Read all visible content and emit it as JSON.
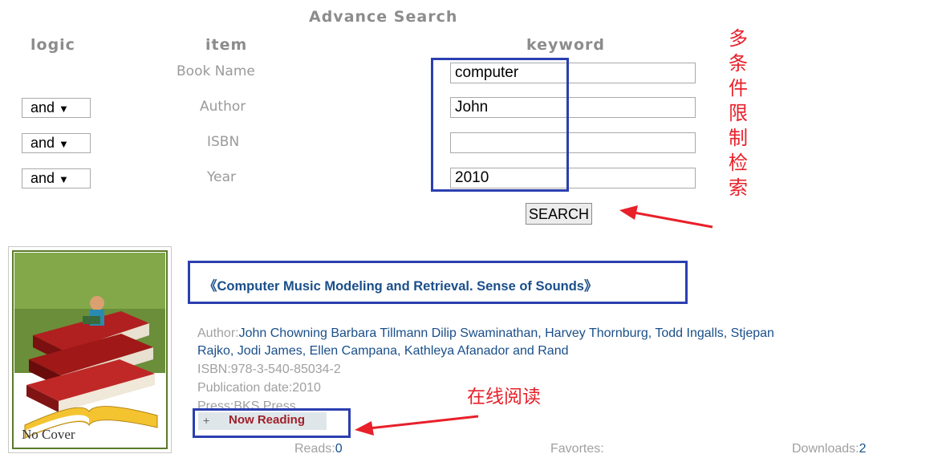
{
  "search": {
    "title": "Advance Search",
    "headers": {
      "logic": "logic",
      "item": "item",
      "keyword": "keyword"
    },
    "rows": [
      {
        "logic": "",
        "item": "Book Name",
        "value": "computer"
      },
      {
        "logic": "and",
        "item": "Author",
        "value": "John"
      },
      {
        "logic": "and",
        "item": "ISBN",
        "value": ""
      },
      {
        "logic": "and",
        "item": "Year",
        "value": "2010"
      }
    ],
    "search_button": "SEARCH",
    "annotation": [
      "多",
      "条",
      "件",
      "限",
      "制",
      "检",
      "索"
    ]
  },
  "result": {
    "cover_text": "No Cover",
    "title": "《Computer Music Modeling and Retrieval. Sense of Sounds》",
    "author_label": "Author:",
    "author_value_line1": "John Chowning Barbara Tillmann Dilip Swaminathan, Harvey Thornburg, Todd Ingalls, Stjepan",
    "author_value_line2": "Rajko, Jodi James, Ellen Campana, Kathleya Afanador and Rand",
    "isbn": "ISBN:978-3-540-85034-2",
    "pubdate": "Publication date:2010",
    "press": "Press:BKS Press",
    "now_reading_plus": "+",
    "now_reading": "Now Reading",
    "annotation": "在线阅读",
    "reads_label": "Reads:",
    "reads_value": "0",
    "favorites_label": "Favortes:",
    "downloads_label": "Downloads:",
    "downloads_value": "2"
  },
  "colors": {
    "annotation_red": "#e8202a",
    "highlight_blue": "#2b3fb0",
    "link": "#1a4f8a"
  }
}
